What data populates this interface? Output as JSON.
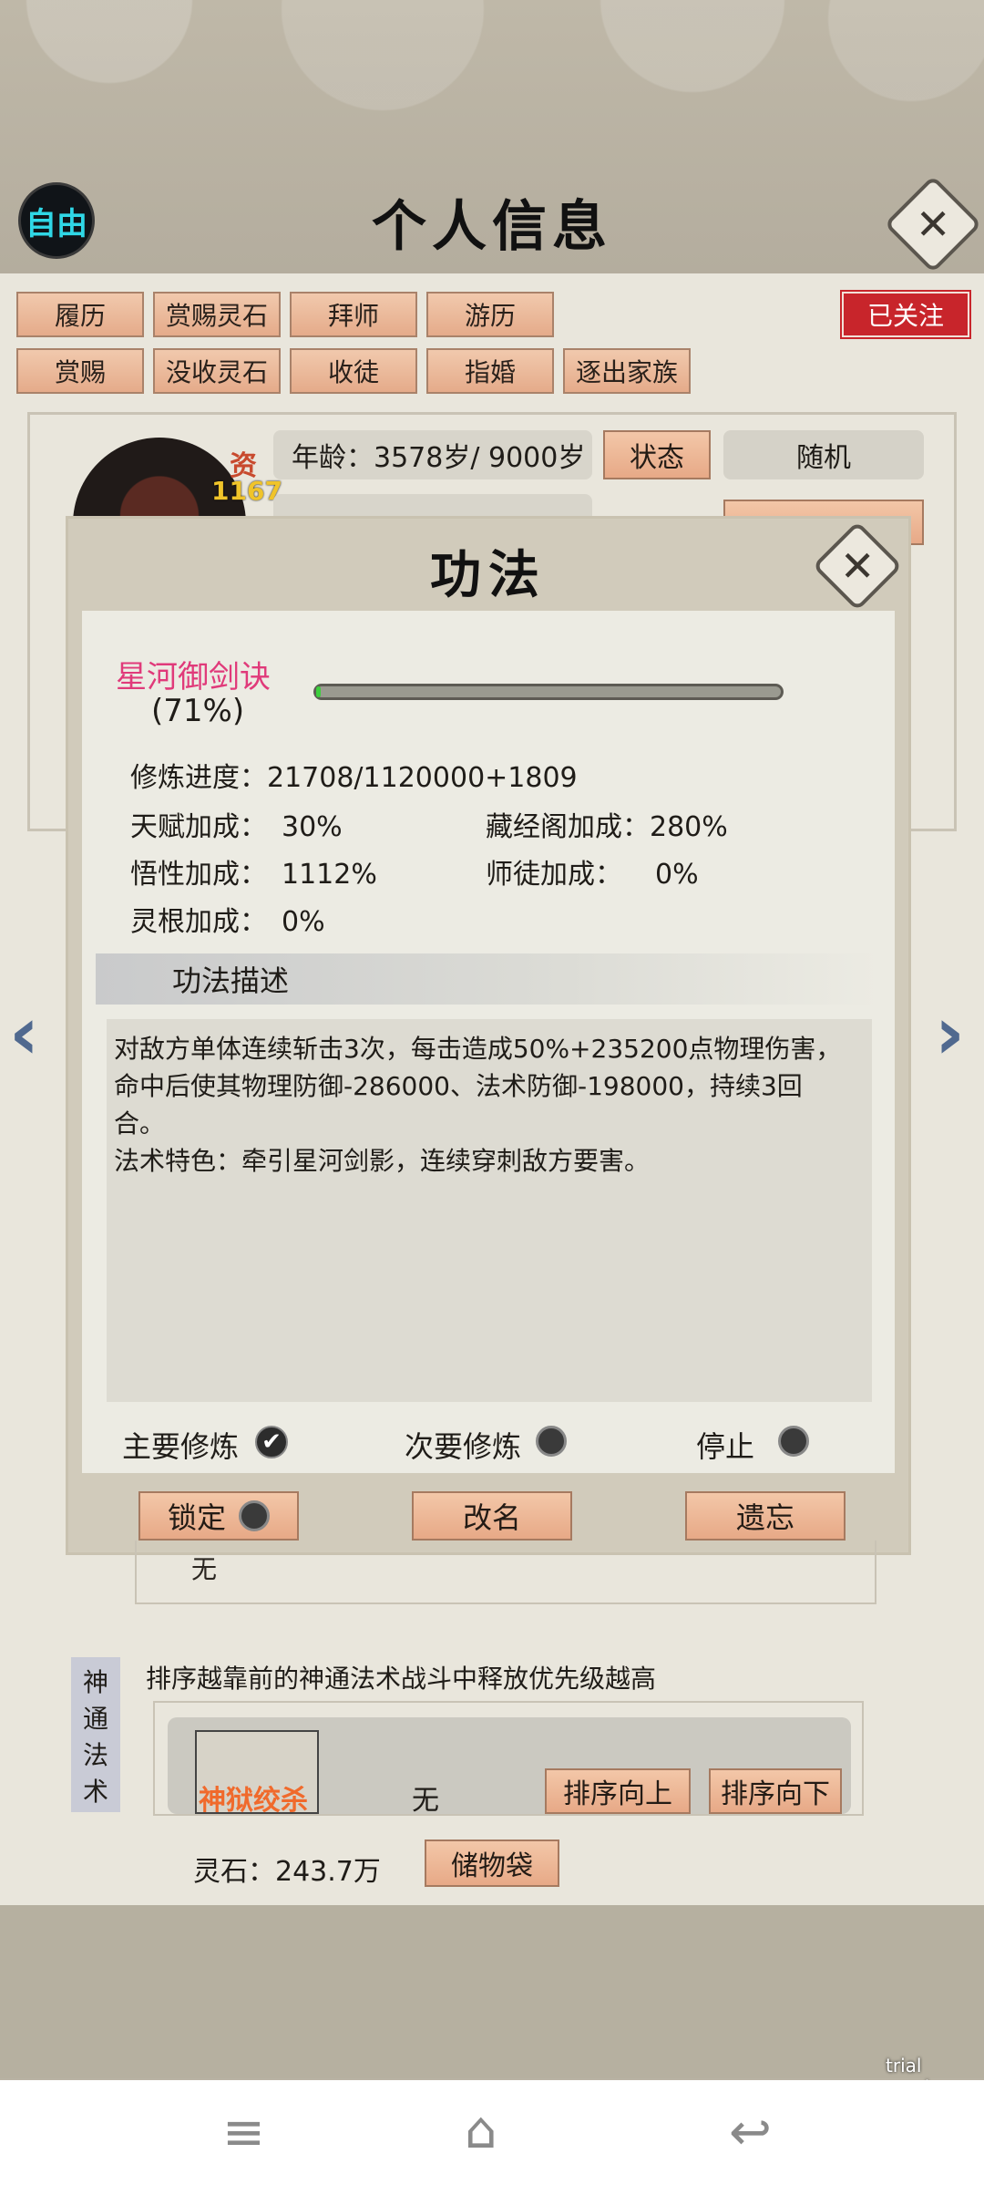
{
  "header": {
    "title": "个人信息",
    "free_badge": "自由",
    "close_icon": "✕"
  },
  "tabs_row1": [
    "履历",
    "赏赐灵石",
    "拜师",
    "游历"
  ],
  "tabs_row2": [
    "赏赐",
    "没收灵石",
    "收徒",
    "指婚",
    "逐出家族"
  ],
  "followed_label": "已关注",
  "profile": {
    "zi_label": "资",
    "zi_value": "1167",
    "age_text": "年龄：3578岁/ 9000岁",
    "status_button": "状态",
    "random_button": "随机"
  },
  "modal": {
    "title": "功法",
    "close_icon": "✕",
    "technique_name": "星河御剑诀",
    "progress_text": "(71%)",
    "progress_fraction": 0.005,
    "cultivation_label": "修炼进度：",
    "cultivation_value": "21708/1120000+1809",
    "stats": {
      "talent_label": "天赋加成：",
      "talent_value": "30%",
      "library_label": "藏经阁加成：",
      "library_value": "280%",
      "comprehension_label": "悟性加成：",
      "comprehension_value": "1112%",
      "mentor_label": "师徒加成：",
      "mentor_value": "0%",
      "root_label": "灵根加成：",
      "root_value": "0%"
    },
    "desc_heading": "功法描述",
    "description": "对敌方单体连续斩击3次，每击造成50%+235200点物理伤害，\n命中后使其物理防御-286000、法术防御-198000，持续3回\n合。\n法术特色：牵引星河剑影，连续穿刺敌方要害。",
    "options": {
      "primary": "主要修炼",
      "secondary": "次要修炼",
      "stop": "停止"
    },
    "buttons": {
      "lock": "锁定",
      "rename": "改名",
      "forget": "遗忘"
    }
  },
  "lower": {
    "none_text": "无",
    "shentong_tag": [
      "神",
      "通",
      "法",
      "术"
    ],
    "shentong_note": "排序越靠前的神通法术战斗中释放优先级越高",
    "skill_name": "神狱绞杀",
    "skill_none": "无",
    "sort_up": "排序向上",
    "sort_down": "排序向下",
    "spirit_stone": "灵石：243.7万",
    "storage_bag": "储物袋"
  },
  "nav_arrows": {
    "left": "‹",
    "right": "›"
  },
  "trial_text": "trial version",
  "system_nav": {
    "menu": "≡",
    "home": "⌂",
    "back": "↩"
  }
}
